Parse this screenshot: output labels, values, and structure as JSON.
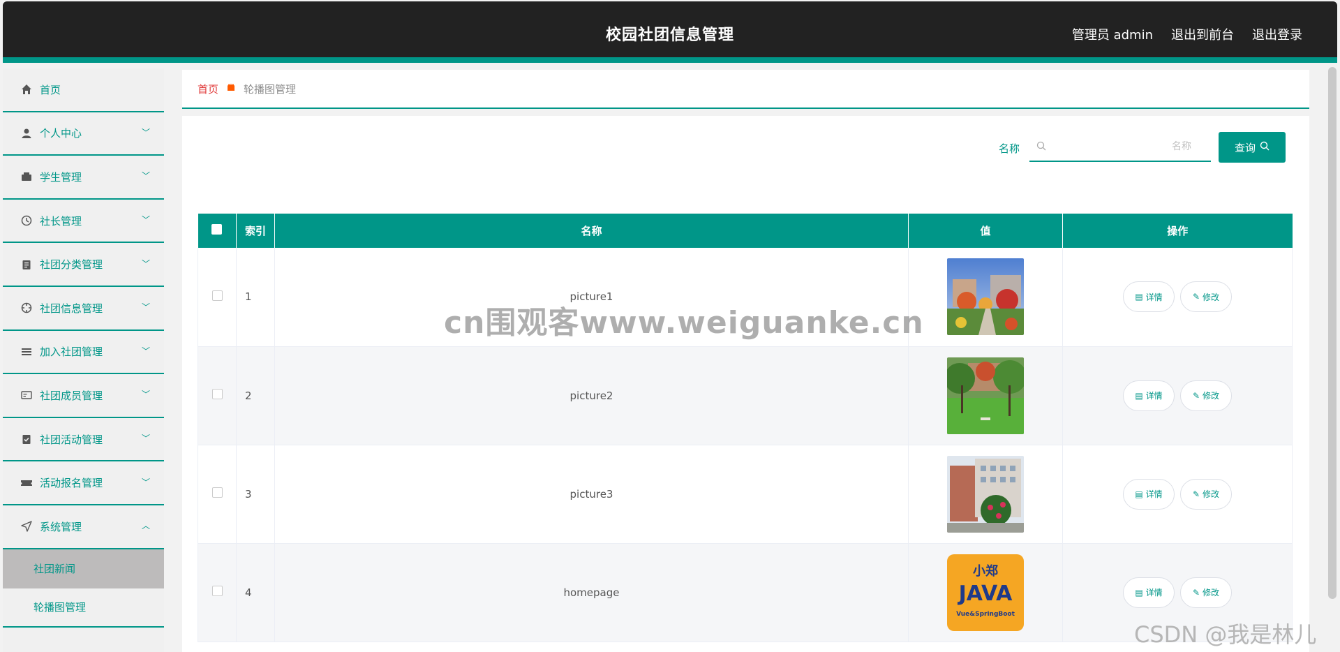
{
  "header": {
    "title": "校园社团信息管理",
    "user": "管理员 admin",
    "front_link": "退出到前台",
    "logout_link": "退出登录"
  },
  "sidebar": {
    "items": [
      {
        "label": "首页",
        "icon": "home-icon"
      },
      {
        "label": "个人中心",
        "icon": "user-icon"
      },
      {
        "label": "学生管理",
        "icon": "wallet-icon"
      },
      {
        "label": "社长管理",
        "icon": "clock-icon"
      },
      {
        "label": "社团分类管理",
        "icon": "clipboard-icon"
      },
      {
        "label": "社团信息管理",
        "icon": "target-icon"
      },
      {
        "label": "加入社团管理",
        "icon": "list-icon"
      },
      {
        "label": "社团成员管理",
        "icon": "card-icon"
      },
      {
        "label": "社团活动管理",
        "icon": "checklist-icon"
      },
      {
        "label": "活动报名管理",
        "icon": "ticket-icon"
      },
      {
        "label": "系统管理",
        "icon": "navigation-icon"
      }
    ],
    "sub_items": [
      {
        "label": "社团新闻"
      },
      {
        "label": "轮播图管理"
      }
    ]
  },
  "breadcrumb": {
    "home": "首页",
    "current": "轮播图管理"
  },
  "search": {
    "label": "名称",
    "placeholder": "名称",
    "value": "",
    "button_label": "查询"
  },
  "table": {
    "headers": [
      "索引",
      "名称",
      "值",
      "操作"
    ],
    "rows": [
      {
        "index": "1",
        "name": "picture1"
      },
      {
        "index": "2",
        "name": "picture2"
      },
      {
        "index": "3",
        "name": "picture3"
      },
      {
        "index": "4",
        "name": "homepage"
      }
    ],
    "detail_label": "详情",
    "edit_label": "修改"
  },
  "thumbs": {
    "homepage_top": "小郑",
    "homepage_main": "JAVA",
    "homepage_sub": "Vue&SpringBoot"
  },
  "watermarks": {
    "center": "cn围观客www.weiguanke.cn",
    "corner": "CSDN @我是林儿"
  },
  "colors": {
    "accent": "#009688",
    "header_bg": "#222222",
    "breadcrumb_home": "#e03b3b"
  }
}
